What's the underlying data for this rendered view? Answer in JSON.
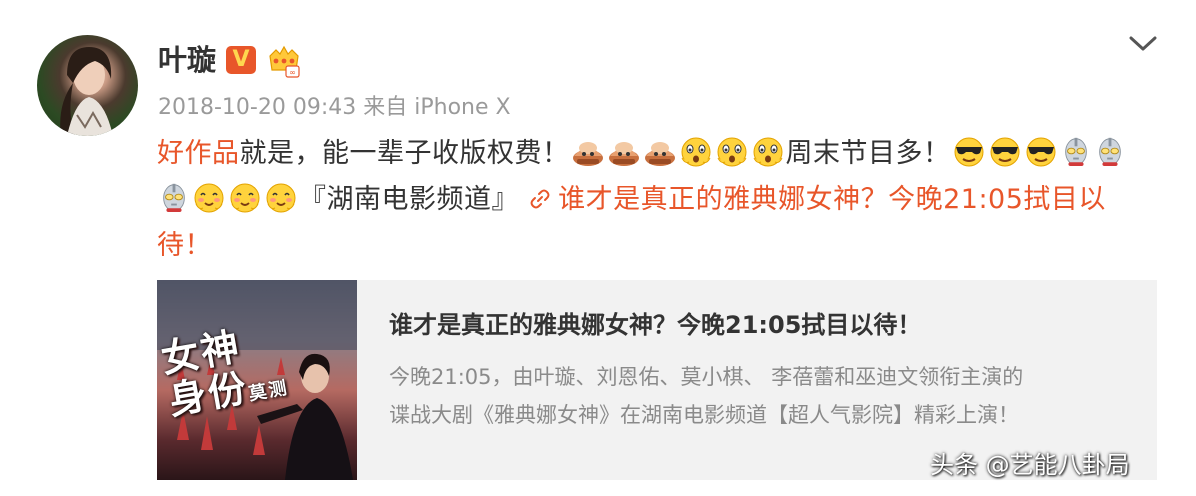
{
  "post": {
    "username": "叶璇",
    "verified_badge": "V",
    "member_badge_icon": "crown-icon",
    "timestamp": "2018-10-20 09:43",
    "source": "来自 iPhone X",
    "text": {
      "topic": "好作品",
      "part1": "就是，能一辈子收版权费！",
      "part2": "周末节目多！",
      "part3": "『湖南电影频道』",
      "link_text": "谁才是真正的雅典娜女神？今晚21:05拭目以待！"
    },
    "emojis": [
      "bowl-emoji",
      "bowl-emoji",
      "bowl-emoji",
      "astonished-emoji",
      "astonished-emoji",
      "astonished-emoji",
      "sunglasses-emoji",
      "sunglasses-emoji",
      "sunglasses-emoji",
      "ultraman-emoji",
      "ultraman-emoji",
      "ultraman-emoji",
      "blush-emoji",
      "blush-emoji",
      "blush-emoji"
    ]
  },
  "card": {
    "thumb_text_1": "女神",
    "thumb_text_2": "身份",
    "thumb_text_3": "莫测",
    "title": "谁才是真正的雅典娜女神？今晚21:05拭目以待！",
    "desc_line1": "今晚21:05，由叶璇、刘恩佑、莫小棋、 李蓓蕾和巫迪文领衔主演的",
    "desc_line2": "谍战大剧《雅典娜女神》在湖南电影频道【超人气影院】精彩上演！"
  },
  "watermark": "头条 @艺能八卦局",
  "colors": {
    "accent": "#e8562a",
    "meta_gray": "#9a9a9a",
    "card_bg": "#f2f2f2"
  }
}
